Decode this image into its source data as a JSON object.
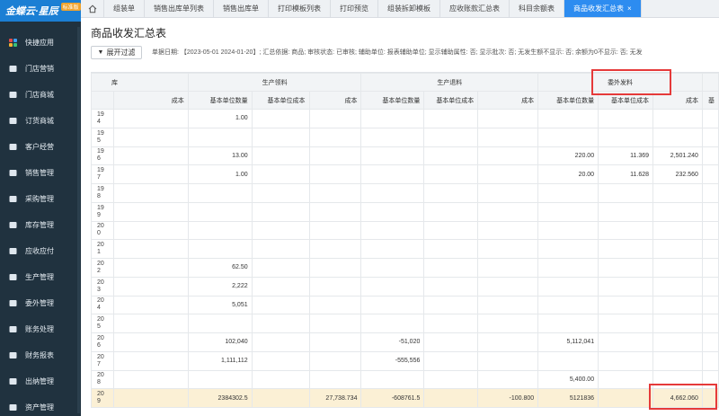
{
  "logo": {
    "text": "金蝶云·星辰",
    "badge": "标准版"
  },
  "sidebar": {
    "items": [
      {
        "label": "快捷应用",
        "icon": "grid-icon"
      },
      {
        "label": "门店营销",
        "icon": "store-icon"
      },
      {
        "label": "门店商城",
        "icon": "mall-icon"
      },
      {
        "label": "订货商城",
        "icon": "order-mall-icon"
      },
      {
        "label": "客户经营",
        "icon": "customer-icon"
      },
      {
        "label": "销售管理",
        "icon": "sales-icon"
      },
      {
        "label": "采购管理",
        "icon": "cart-icon"
      },
      {
        "label": "库存管理",
        "icon": "warehouse-icon"
      },
      {
        "label": "应收应付",
        "icon": "ledger-icon"
      },
      {
        "label": "生产管理",
        "icon": "factory-icon"
      },
      {
        "label": "委外管理",
        "icon": "outsource-icon"
      },
      {
        "label": "账务处理",
        "icon": "accounting-icon"
      },
      {
        "label": "财务报表",
        "icon": "report-icon"
      },
      {
        "label": "出纳管理",
        "icon": "cashier-icon"
      },
      {
        "label": "资产管理",
        "icon": "asset-icon"
      }
    ]
  },
  "tabs": [
    {
      "label": "组装单",
      "active": false
    },
    {
      "label": "销售出库单列表",
      "active": false
    },
    {
      "label": "销售出库单",
      "active": false
    },
    {
      "label": "打印模板列表",
      "active": false
    },
    {
      "label": "打印预览",
      "active": false
    },
    {
      "label": "组装拆卸模板",
      "active": false
    },
    {
      "label": "应收账款汇总表",
      "active": false
    },
    {
      "label": "科目余额表",
      "active": false
    },
    {
      "label": "商品收发汇总表",
      "active": true
    }
  ],
  "page": {
    "title": "商品收发汇总表",
    "filter_label": "展开过滤",
    "summary": "单据日期: 【2023-05-01 2024-01-20】; 汇总依据: 商品; 审核状态: 已审核; 辅助单位: 报表辅助单位; 显示辅助属性: 否; 显示批次: 否; 无发生额不显示: 否; 余额为0不显示: 否; 无发"
  },
  "table": {
    "group_headers": [
      "库",
      "生产领料",
      "生产退料",
      "委外发料",
      ""
    ],
    "sub_headers": [
      "",
      "成本",
      "基本单位数量",
      "基本单位成本",
      "成本",
      "基本单位数量",
      "基本单位成本",
      "成本",
      "基本单位数量",
      "基本单位成本",
      "成本",
      "基"
    ],
    "rows": [
      {
        "idx": "194",
        "cells": [
          "",
          "1.00",
          "",
          "",
          "",
          "",
          "",
          "",
          "",
          "",
          ""
        ]
      },
      {
        "idx": "195",
        "cells": [
          "",
          "",
          "",
          "",
          "",
          "",
          "",
          "",
          "",
          "",
          ""
        ]
      },
      {
        "idx": "196",
        "cells": [
          "",
          "13.00",
          "",
          "",
          "",
          "",
          "",
          "220.00",
          "11.369",
          "2,501.240",
          ""
        ]
      },
      {
        "idx": "197",
        "cells": [
          "",
          "1.00",
          "",
          "",
          "",
          "",
          "",
          "20.00",
          "11.628",
          "232.560",
          ""
        ]
      },
      {
        "idx": "198",
        "cells": [
          "",
          "",
          "",
          "",
          "",
          "",
          "",
          "",
          "",
          "",
          ""
        ]
      },
      {
        "idx": "199",
        "cells": [
          "",
          "",
          "",
          "",
          "",
          "",
          "",
          "",
          "",
          "",
          ""
        ]
      },
      {
        "idx": "200",
        "cells": [
          "",
          "",
          "",
          "",
          "",
          "",
          "",
          "",
          "",
          "",
          ""
        ]
      },
      {
        "idx": "201",
        "cells": [
          "",
          "",
          "",
          "",
          "",
          "",
          "",
          "",
          "",
          "",
          ""
        ]
      },
      {
        "idx": "202",
        "cells": [
          "",
          "62.50",
          "",
          "",
          "",
          "",
          "",
          "",
          "",
          "",
          ""
        ]
      },
      {
        "idx": "203",
        "cells": [
          "",
          "2,222",
          "",
          "",
          "",
          "",
          "",
          "",
          "",
          "",
          ""
        ]
      },
      {
        "idx": "204",
        "cells": [
          "",
          "5,051",
          "",
          "",
          "",
          "",
          "",
          "",
          "",
          "",
          ""
        ]
      },
      {
        "idx": "205",
        "cells": [
          "",
          "",
          "",
          "",
          "",
          "",
          "",
          "",
          "",
          "",
          ""
        ]
      },
      {
        "idx": "206",
        "cells": [
          "",
          "102,040",
          "",
          "",
          "-51,020",
          "",
          "",
          "5,112,041",
          "",
          "",
          ""
        ]
      },
      {
        "idx": "207",
        "cells": [
          "",
          "1,111,112",
          "",
          "",
          "-555,556",
          "",
          "",
          "",
          "",
          "",
          ""
        ]
      },
      {
        "idx": "208",
        "cells": [
          "",
          "",
          "",
          "",
          "",
          "",
          "",
          "5,400.00",
          "",
          "",
          ""
        ]
      }
    ],
    "sum_row": {
      "idx": "209",
      "cells": [
        "",
        "2384302.5",
        "",
        "27,738.734",
        "-608761.5",
        "",
        "-100.800",
        "5121836",
        "",
        "4,662.060",
        ""
      ]
    }
  },
  "colors": {
    "sidebar_bg": "#20323f",
    "active_tab": "#2d8cf0",
    "sum_row": "#fbf0d5",
    "highlight": "#e53a3a"
  }
}
